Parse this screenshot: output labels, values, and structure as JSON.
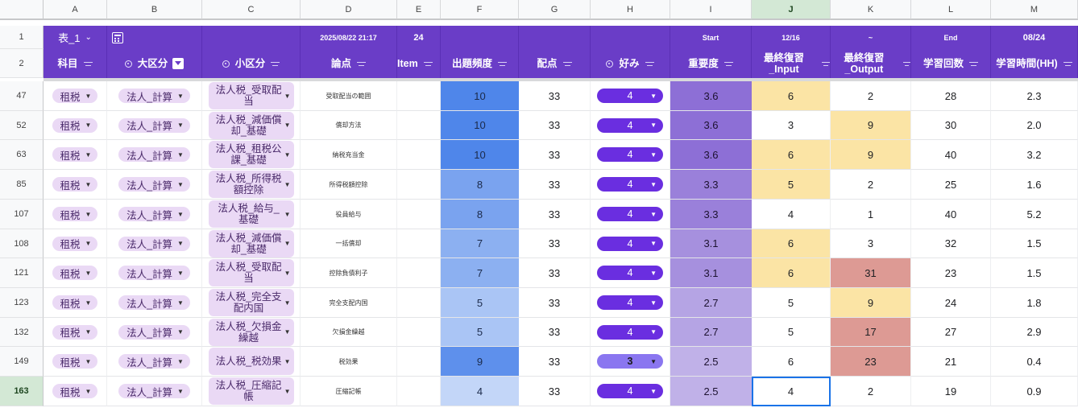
{
  "columns": [
    "A",
    "B",
    "C",
    "D",
    "E",
    "F",
    "G",
    "H",
    "I",
    "J",
    "K",
    "L",
    "M"
  ],
  "selected_column": "J",
  "toolbar_row": {
    "row_number": "1",
    "sheet_name": "表_1",
    "sheet_icon": "chevron-down-icon",
    "view_icon": "calculator-icon",
    "d_datetime": "2025/08/22 21:17",
    "e_value": "24",
    "i_label": "Start",
    "j_value": "12/16",
    "k_value": "~",
    "l_label": "End",
    "m_value": "08/24"
  },
  "header_row": {
    "row_number": "2",
    "labels": [
      "科目",
      "大区分",
      "小区分",
      "論点",
      "Item",
      "出題頻度",
      "配点",
      "好み",
      "重要度",
      "最終復習_Input",
      "最終復習_Output",
      "学習回数",
      "学習時間(HH)"
    ]
  },
  "rows": [
    {
      "row": "47",
      "a": "租税",
      "b": "法人_計算",
      "c": "法人税_受取配当",
      "d": "受取配当の範囲",
      "f": "10",
      "g": "33",
      "h": "4",
      "i": "3.6",
      "j": "6",
      "k": "2",
      "l": "28",
      "m": "2.3"
    },
    {
      "row": "52",
      "a": "租税",
      "b": "法人_計算",
      "c": "法人税_減価償却_基礎",
      "d": "償却方法",
      "f": "10",
      "g": "33",
      "h": "4",
      "i": "3.6",
      "j": "3",
      "k": "9",
      "l": "30",
      "m": "2.0"
    },
    {
      "row": "63",
      "a": "租税",
      "b": "法人_計算",
      "c": "法人税_租税公課_基礎",
      "d": "納税充当金",
      "f": "10",
      "g": "33",
      "h": "4",
      "i": "3.6",
      "j": "6",
      "k": "9",
      "l": "40",
      "m": "3.2"
    },
    {
      "row": "85",
      "a": "租税",
      "b": "法人_計算",
      "c": "法人税_所得税額控除",
      "d": "所得税額控除",
      "f": "8",
      "g": "33",
      "h": "4",
      "i": "3.3",
      "j": "5",
      "k": "2",
      "l": "25",
      "m": "1.6"
    },
    {
      "row": "107",
      "a": "租税",
      "b": "法人_計算",
      "c": "法人税_給与_基礎",
      "d": "役員給与",
      "f": "8",
      "g": "33",
      "h": "4",
      "i": "3.3",
      "j": "4",
      "k": "1",
      "l": "40",
      "m": "5.2"
    },
    {
      "row": "108",
      "a": "租税",
      "b": "法人_計算",
      "c": "法人税_減価償却_基礎",
      "d": "一括償却",
      "f": "7",
      "g": "33",
      "h": "4",
      "i": "3.1",
      "j": "6",
      "k": "3",
      "l": "32",
      "m": "1.5"
    },
    {
      "row": "121",
      "a": "租税",
      "b": "法人_計算",
      "c": "法人税_受取配当",
      "d": "控除負債利子",
      "f": "7",
      "g": "33",
      "h": "4",
      "i": "3.1",
      "j": "6",
      "k": "31",
      "l": "23",
      "m": "1.5"
    },
    {
      "row": "123",
      "a": "租税",
      "b": "法人_計算",
      "c": "法人税_完全支配内国",
      "d": "完全支配内国",
      "f": "5",
      "g": "33",
      "h": "4",
      "i": "2.7",
      "j": "5",
      "k": "9",
      "l": "24",
      "m": "1.8"
    },
    {
      "row": "132",
      "a": "租税",
      "b": "法人_計算",
      "c": "法人税_欠損金繰越",
      "d": "欠損金繰越",
      "f": "5",
      "g": "33",
      "h": "4",
      "i": "2.7",
      "j": "5",
      "k": "17",
      "l": "27",
      "m": "2.9"
    },
    {
      "row": "149",
      "a": "租税",
      "b": "法人_計算",
      "c": "法人税_税効果",
      "d": "税効果",
      "f": "9",
      "g": "33",
      "h": "3",
      "i": "2.5",
      "j": "6",
      "k": "23",
      "l": "21",
      "m": "0.4"
    },
    {
      "row": "163",
      "a": "租税",
      "b": "法人_計算",
      "c": "法人税_圧縮記帳",
      "d": "圧縮記帳",
      "f": "4",
      "g": "33",
      "h": "4",
      "i": "2.5",
      "j": "4",
      "k": "2",
      "l": "19",
      "m": "0.9"
    }
  ],
  "selected_row": "163",
  "colors": {
    "header_purple": "#6a3dc7",
    "chip_bg": "#ead9f5",
    "pill_purple": "#6a2ee0",
    "pill_light": "#8a76f0",
    "highlight_yellow": "#fbe4a5",
    "highlight_red": "#dd9a94",
    "selection_blue": "#1a73e8"
  },
  "f_colors": [
    "#4f86ea",
    "#4f86ea",
    "#4f86ea",
    "#7aa3ef",
    "#7aa3ef",
    "#8cb0f1",
    "#8cb0f1",
    "#aac5f5",
    "#aac5f5",
    "#5e90ec",
    "#c3d6f8"
  ],
  "i_colors": [
    "#8d6fd6",
    "#8d6fd6",
    "#8d6fd6",
    "#9a80da",
    "#9a80da",
    "#a690de",
    "#a690de",
    "#b5a4e4",
    "#b5a4e4",
    "#c0b1e8",
    "#c0b1e8"
  ],
  "j_colors": [
    "#fbe4a5",
    "",
    "#fbe4a5",
    "#fbe4a5",
    "",
    "#fbe4a5",
    "#fbe4a5",
    "",
    "",
    "",
    ""
  ],
  "k_colors": [
    "",
    "#fbe4a5",
    "#fbe4a5",
    "",
    "",
    "",
    "#dd9a94",
    "#fbe4a5",
    "#dd9a94",
    "#dd9a94",
    ""
  ],
  "h_light": [
    false,
    false,
    false,
    false,
    false,
    false,
    false,
    false,
    false,
    true,
    false
  ]
}
